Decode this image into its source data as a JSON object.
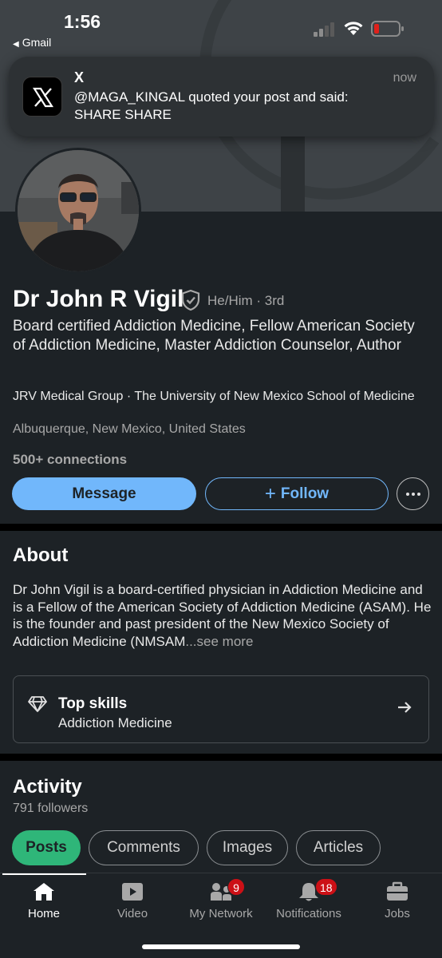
{
  "status_bar": {
    "time": "1:56",
    "back_label": "Gmail",
    "back_arrow": "◀"
  },
  "notification": {
    "app_name": "X",
    "time": "now",
    "message_line1": "@MAGA_KINGAL quoted your post and said:",
    "message_line2": "SHARE SHARE",
    "icon": "x-logo-icon"
  },
  "profile": {
    "name": "Dr John R Vigil",
    "pronouns_degree": "He/Him · 3rd",
    "headline": "Board certified Addiction Medicine, Fellow American Society of Addiction Medicine, Master Addiction Counselor, Author",
    "company": "JRV Medical Group · The University of New Mexico School of Medicine",
    "location": "Albuquerque, New Mexico, United States",
    "connections": "500+ connections",
    "message_label": "Message",
    "follow_label": "Follow",
    "follow_icon": "+"
  },
  "about": {
    "title": "About",
    "text": "Dr John Vigil is a board-certified physician in Addiction Medicine and is a Fellow of the American Society of Addiction Medicine (ASAM). He is the founder and past president of the New Mexico Society of Addiction Medicine (NMSAM",
    "ellipsis": "...",
    "see_more": "see more",
    "top_skills_title": "Top skills",
    "top_skills_value": "Addiction Medicine"
  },
  "activity": {
    "title": "Activity",
    "followers": "791 followers",
    "tabs": [
      {
        "label": "Posts",
        "active": true
      },
      {
        "label": "Comments",
        "active": false
      },
      {
        "label": "Images",
        "active": false
      },
      {
        "label": "Articles",
        "active": false
      }
    ]
  },
  "bottom_nav": {
    "items": [
      {
        "label": "Home",
        "icon": "home-icon",
        "active": true
      },
      {
        "label": "Video",
        "icon": "video-icon",
        "active": false
      },
      {
        "label": "My Network",
        "icon": "network-icon",
        "badge": "9"
      },
      {
        "label": "Notifications",
        "icon": "bell-icon",
        "badge": "18"
      },
      {
        "label": "Jobs",
        "icon": "briefcase-icon",
        "active": false
      }
    ]
  },
  "colors": {
    "background": "#1d2226",
    "accent_blue": "#71b7fb",
    "active_green": "#2fb679",
    "badge_red": "#cc1016",
    "battery_low": "#e0211b"
  }
}
